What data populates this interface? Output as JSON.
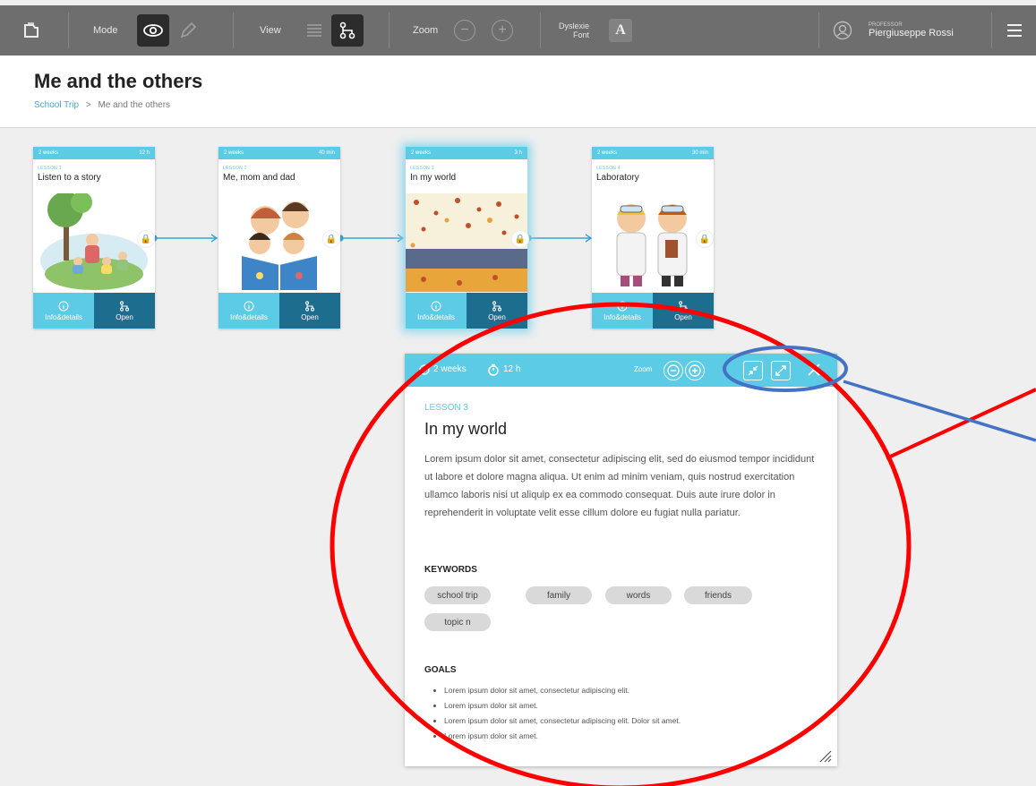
{
  "toolbar": {
    "mode_label": "Mode",
    "view_label": "View",
    "zoom_label": "Zoom",
    "zoom_out": "−",
    "zoom_in": "+",
    "dyslexia_line1": "Dyslexie",
    "dyslexia_line2": "Font",
    "font_glyph": "A",
    "user_role": "PROFESSOR",
    "user_name": "Piergiuseppe Rossi"
  },
  "page": {
    "title": "Me and the others",
    "breadcrumb": [
      "School Trip",
      ">",
      "Me and the others"
    ]
  },
  "lessons": [
    {
      "duration": "2 weeks",
      "hours": "12 h",
      "label": "LESSON 1",
      "title": "Listen to a story",
      "info": "Info&details",
      "open": "Open"
    },
    {
      "duration": "2 weeks",
      "hours": "40 min",
      "label": "LESSON 2",
      "title": "Me, mom and dad",
      "info": "Info&details",
      "open": "Open"
    },
    {
      "duration": "2 weeks",
      "hours": "3 h",
      "label": "LESSON 3",
      "title": "In my world",
      "info": "Info&details",
      "open": "Open"
    },
    {
      "duration": "2 weeks",
      "hours": "30 min",
      "label": "LESSON 4",
      "title": "Laboratory",
      "info": "Info&details",
      "open": "Open"
    }
  ],
  "detail": {
    "duration": "2 weeks",
    "hours": "12 h",
    "zoom_label": "Zoom",
    "lesson_label": "LESSON 3",
    "title": "In my world",
    "description": "Lorem ipsum dolor sit amet, consectetur adipiscing elit, sed do eiusmod tempor incididunt ut labore et dolore magna aliqua. Ut enim ad minim veniam, quis nostrud exercitation ullamco laboris nisi ut aliquip ex ea commodo consequat. Duis aute irure dolor in reprehenderit in voluptate velit esse cillum dolore eu fugiat nulla pariatur.",
    "keywords_heading": "KEYWORDS",
    "keywords": [
      "school trip",
      "family",
      "words",
      "friends",
      "topic n"
    ],
    "goals_heading": "GOALS",
    "goals": [
      "Lorem ipsum dolor sit amet, consectetur adipiscing elit.",
      "Lorem ipsum dolor sit amet.",
      "Lorem ipsum dolor sit amet, consectetur adipiscing elit. Dolor sit amet.",
      "Lorem ipsum dolor sit amet."
    ]
  },
  "colors": {
    "accent": "#5ccbe6",
    "accent_dark": "#1d6e8e",
    "toolbar": "#6e6e6e",
    "annotation_red": "#ff0000",
    "annotation_blue": "#4472c4"
  },
  "icons": [
    "folder-icon",
    "eye-icon",
    "pencil-icon",
    "list-view-icon",
    "flow-view-icon",
    "zoom-out-icon",
    "zoom-in-icon",
    "user-icon",
    "menu-icon",
    "info-icon",
    "flow-icon",
    "lock-icon",
    "timer-icon",
    "collapse-icon",
    "expand-icon",
    "close-icon",
    "resize-grip-icon"
  ]
}
